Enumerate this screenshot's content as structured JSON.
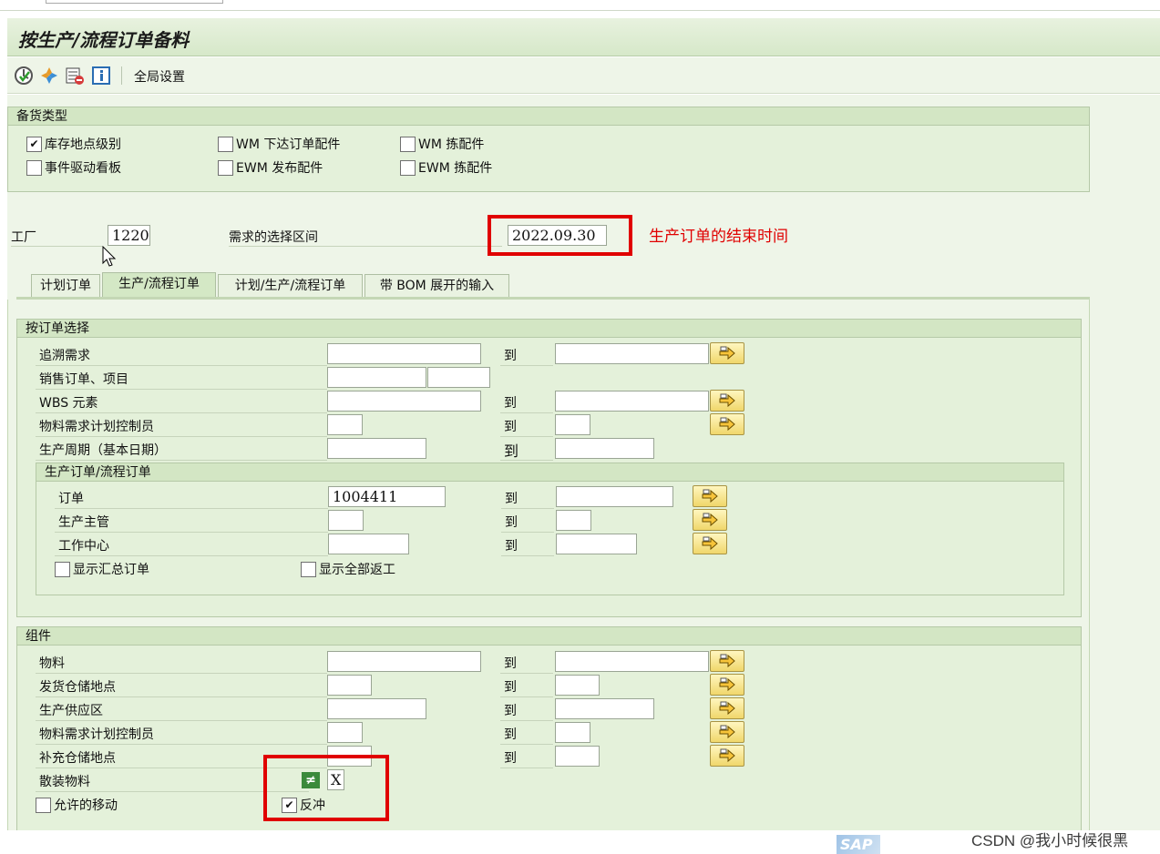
{
  "title": "按生产/流程订单备料",
  "toolbar": {
    "icons": [
      "execute-icon",
      "find-icon",
      "variant-icon",
      "info-icon"
    ],
    "global_settings": "全局设置"
  },
  "staging_type": {
    "title": "备货类型",
    "options": [
      {
        "label": "库存地点级别",
        "checked": true
      },
      {
        "label": "WM 下达订单配件",
        "checked": false
      },
      {
        "label": "WM 拣配件",
        "checked": false
      },
      {
        "label": "事件驱动看板",
        "checked": false
      },
      {
        "label": "EWM 发布配件",
        "checked": false
      },
      {
        "label": "EWM 拣配件",
        "checked": false
      }
    ]
  },
  "plant": {
    "label": "工厂",
    "value": "1220"
  },
  "requirement_interval": {
    "label": "需求的选择区间",
    "value": "2022.09.30"
  },
  "annotation": "生产订单的结束时间",
  "tabs": [
    "计划订单",
    "生产/流程订单",
    "计划/生产/流程订单",
    "带 BOM 展开的输入"
  ],
  "active_tab": 1,
  "order_selection": {
    "title": "按订单选择",
    "to": "到",
    "rows": [
      {
        "label": "追溯需求",
        "value": ""
      },
      {
        "label": "销售订单、项目",
        "value": ""
      },
      {
        "label": "WBS 元素",
        "value": ""
      },
      {
        "label": "物料需求计划控制员",
        "value": ""
      },
      {
        "label": "生产周期（基本日期）",
        "value": ""
      }
    ],
    "sub": {
      "title": "生产订单/流程订单",
      "rows": [
        {
          "label": "订单",
          "value": "1004411"
        },
        {
          "label": "生产主管",
          "value": ""
        },
        {
          "label": "工作中心",
          "value": ""
        }
      ],
      "show_summary": {
        "label": "显示汇总订单",
        "checked": false
      },
      "show_rework": {
        "label": "显示全部返工",
        "checked": false
      }
    }
  },
  "components": {
    "title": "组件",
    "to": "到",
    "rows": [
      {
        "label": "物料",
        "value": ""
      },
      {
        "label": "发货仓储地点",
        "value": ""
      },
      {
        "label": "生产供应区",
        "value": ""
      },
      {
        "label": "物料需求计划控制员",
        "value": ""
      },
      {
        "label": "补充仓储地点",
        "value": ""
      },
      {
        "label": "散装物料",
        "value": "X",
        "operator": "≠"
      }
    ],
    "allowed_movements": {
      "label": "允许的移动",
      "checked": false
    },
    "reversal": {
      "label": "反冲",
      "checked": true
    }
  },
  "watermark": "CSDN @我小时候很黑",
  "sap_logo": "SAP",
  "colors": {
    "highlight": "#e00000",
    "group_bg": "#e4f1da",
    "header_bg": "#d3e6c4"
  }
}
